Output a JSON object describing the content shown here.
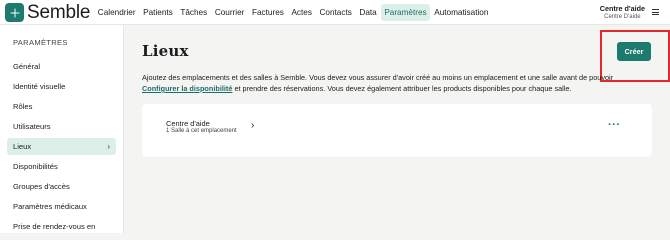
{
  "brand": {
    "name": "Semble",
    "color": "#1d7a6f"
  },
  "nav": {
    "items": [
      "Calendrier",
      "Patients",
      "Tâches",
      "Courrier",
      "Factures",
      "Actes",
      "Contacts",
      "Data",
      "Paramètres",
      "Automatisation"
    ],
    "active": "Paramètres"
  },
  "account": {
    "title": "Centre d'aide",
    "subtitle": "Centre D'aide"
  },
  "sidebar": {
    "heading": "PARAMÈTRES",
    "items": [
      "Général",
      "Identité visuelle",
      "Rôles",
      "Utilisateurs",
      "Lieux",
      "Disponibilités",
      "Groupes d'accès",
      "Paramètres médicaux",
      "Prise de rendez-vous en"
    ],
    "active": "Lieux"
  },
  "main": {
    "title": "Lieux",
    "create_label": "Créer",
    "description_part1": "Ajoutez des emplacements et des salles à Semble. Vous devez vous assurer d'avoir créé au moins un emplacement et une salle avant de pouvoir",
    "description_link": "Configurer la disponibilité",
    "description_part2": "et prendre des réservations. Vous devez également attribuer les products disponibles pour chaque salle."
  },
  "location_card": {
    "name": "Centre d'aide",
    "rooms": "1 Salle à cet emplacement",
    "more": "···"
  },
  "colors": {
    "accent": "#1d7a6f",
    "active_bg": "#dcefe9",
    "highlight": "#e5272b"
  },
  "icons": {
    "chevron": "chevron-right-icon",
    "menu": "hamburger-menu-icon",
    "more": "more-horizontal-icon"
  }
}
